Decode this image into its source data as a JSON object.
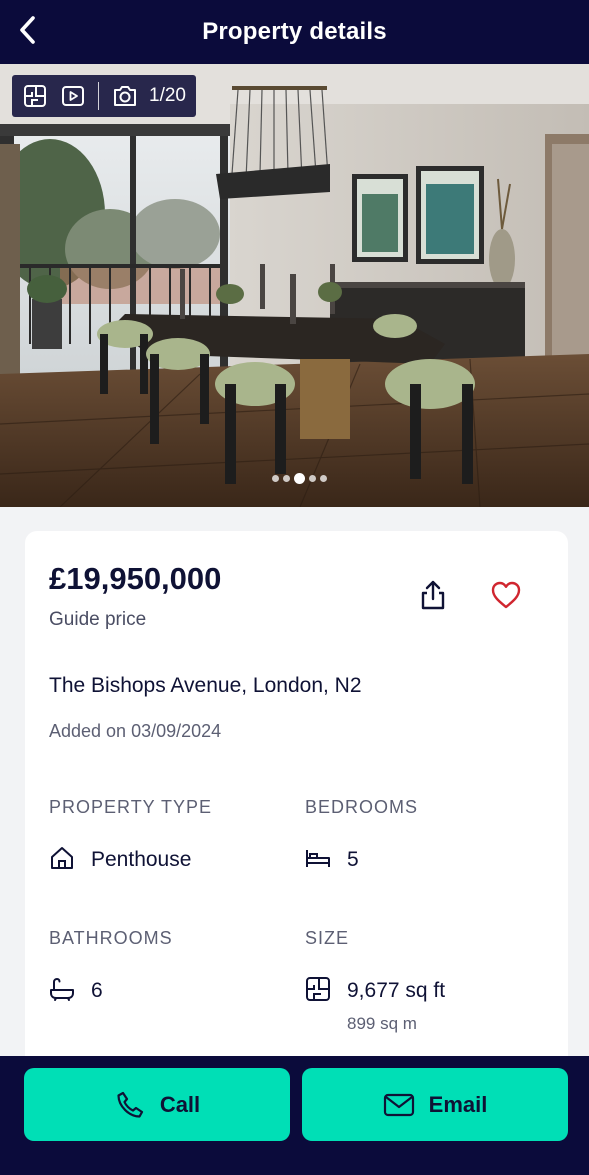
{
  "header": {
    "title": "Property details",
    "back_icon": "chevron-left-icon"
  },
  "gallery": {
    "counter": "1/20",
    "current_index": 1,
    "total": 20,
    "icons": [
      "floorplan-icon",
      "video-icon",
      "camera-icon"
    ],
    "dots_count": 5,
    "active_dot": 3
  },
  "listing": {
    "price": "£19,950,000",
    "price_label": "Guide price",
    "address": "The Bishops Avenue, London, N2",
    "added": "Added on 03/09/2024",
    "share_icon": "share-icon",
    "favorite_icon": "heart-icon",
    "favorite_color": "#d0262f"
  },
  "details": {
    "property_type": {
      "label": "PROPERTY TYPE",
      "value": "Penthouse",
      "icon": "house-icon"
    },
    "bedrooms": {
      "label": "BEDROOMS",
      "value": "5",
      "icon": "bed-icon"
    },
    "bathrooms": {
      "label": "BATHROOMS",
      "value": "6",
      "icon": "bath-icon"
    },
    "size": {
      "label": "SIZE",
      "value": "9,677 sq ft",
      "sub_value": "899 sq m",
      "icon": "floorplan-icon"
    }
  },
  "actions": {
    "call_label": "Call",
    "email_label": "Email",
    "accent_color": "#00dfb6",
    "header_color": "#0b0b3b"
  }
}
